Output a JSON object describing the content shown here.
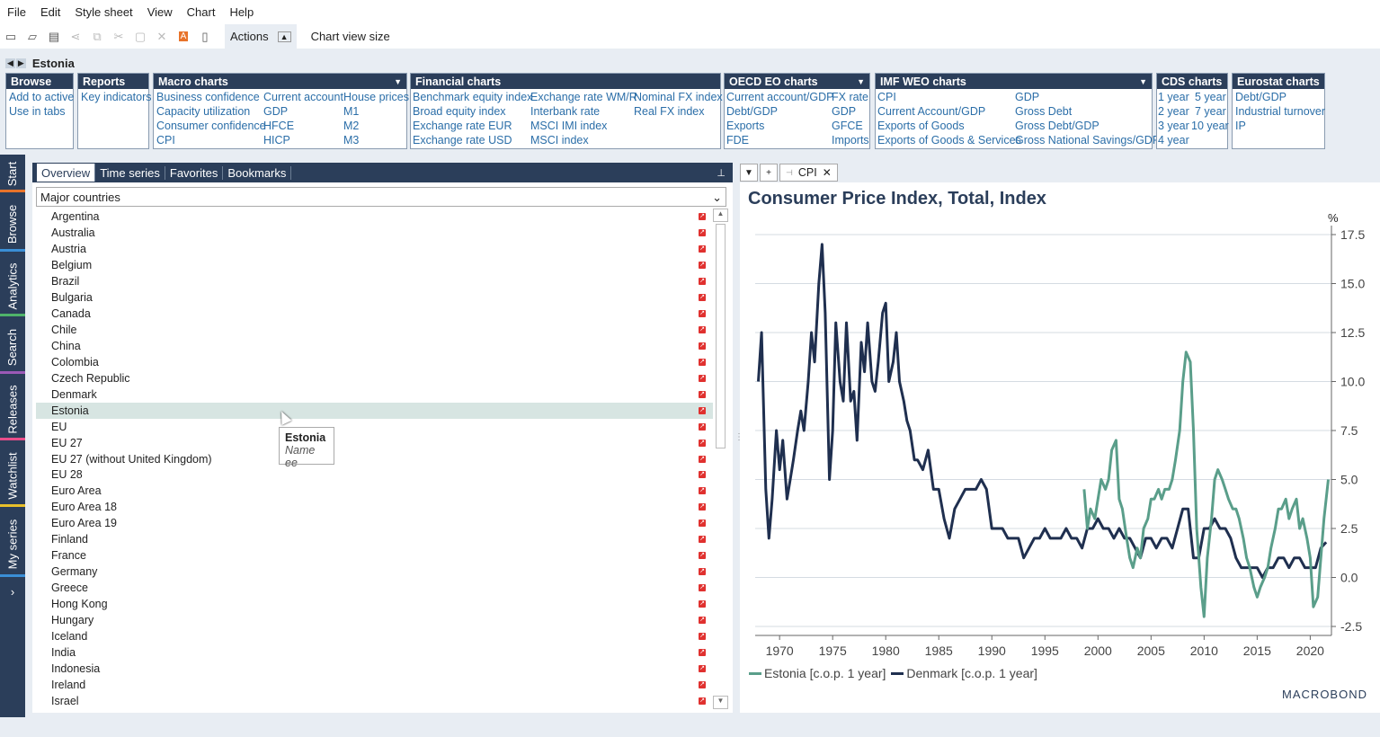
{
  "menu": [
    "File",
    "Edit",
    "Style sheet",
    "View",
    "Chart",
    "Help"
  ],
  "toolbar": {
    "actions_label": "Actions",
    "chart_view_size": "Chart view size"
  },
  "title": "Estonia",
  "panels": {
    "browse": {
      "title": "Browse",
      "items": [
        "Add to active",
        "Use in tabs"
      ]
    },
    "reports": {
      "title": "Reports",
      "items": [
        "Key indicators"
      ]
    },
    "macro": {
      "title": "Macro charts",
      "items": [
        "Business confidence",
        "Capacity utilization",
        "Consumer confidence",
        "CPI",
        "Current account",
        "GDP",
        "HFCE",
        "HICP",
        "House prices",
        "M1",
        "M2",
        "M3"
      ]
    },
    "financial": {
      "title": "Financial charts",
      "items": [
        "Benchmark equity index",
        "Broad equity index",
        "Exchange rate EUR",
        "Exchange rate USD",
        "Exchange rate WM/R",
        "Interbank rate",
        "MSCI IMI index",
        "MSCI index",
        "Nominal FX index",
        "Real FX index"
      ]
    },
    "oecd": {
      "title": "OECD EO charts",
      "items": [
        "Current account/GDP",
        "Debt/GDP",
        "Exports",
        "FDE",
        "FX rate",
        "GDP",
        "GFCE",
        "Imports"
      ]
    },
    "imf": {
      "title": "IMF WEO charts",
      "items": [
        "CPI",
        "Current Account/GDP",
        "Exports of Goods",
        "Exports of Goods & Services",
        "GDP",
        "Gross Debt",
        "Gross Debt/GDP",
        "Gross National Savings/GDP"
      ]
    },
    "cds": {
      "title": "CDS charts",
      "items": [
        "1 year",
        "2 year",
        "3 year",
        "4 year",
        "5 year",
        "7 year",
        "10 year"
      ]
    },
    "eurostat": {
      "title": "Eurostat charts",
      "items": [
        "Debt/GDP",
        "Industrial turnover",
        "IP"
      ]
    }
  },
  "sidetabs": [
    "Start",
    "Browse",
    "Analytics",
    "Search",
    "Releases",
    "Watchlist",
    "My series"
  ],
  "left": {
    "tabs": [
      "Overview",
      "Time series",
      "Favorites",
      "Bookmarks"
    ],
    "dropdown": "Major countries",
    "countries": [
      "Argentina",
      "Australia",
      "Austria",
      "Belgium",
      "Brazil",
      "Bulgaria",
      "Canada",
      "Chile",
      "China",
      "Colombia",
      "Czech Republic",
      "Denmark",
      "Estonia",
      "EU",
      "EU 27",
      "EU 27 (without United Kingdom)",
      "EU 28",
      "Euro Area",
      "Euro Area 18",
      "Euro Area 19",
      "Finland",
      "France",
      "Germany",
      "Greece",
      "Hong Kong",
      "Hungary",
      "Iceland",
      "India",
      "Indonesia",
      "Ireland",
      "Israel"
    ],
    "selected": "Estonia",
    "tooltip": {
      "title": "Estonia",
      "sub": "Name ee"
    }
  },
  "right": {
    "tab": "CPI",
    "brand": "MACROBOND"
  },
  "colors": {
    "estonia": "#5a9e8a",
    "denmark": "#1f2f4f",
    "header": "#2b3e5a",
    "link": "#2b6ea8"
  },
  "chart_data": {
    "type": "line",
    "title": "Consumer Price Index, Total, Index",
    "unit": "%",
    "xlim": [
      1967.7,
      2022
    ],
    "ylim": [
      -2.5,
      17.5
    ],
    "xticks": [
      1970,
      1975,
      1980,
      1985,
      1990,
      1995,
      2000,
      2005,
      2010,
      2015,
      2020
    ],
    "yticks": [
      -2.5,
      0.0,
      2.5,
      5.0,
      7.5,
      10.0,
      12.5,
      15.0,
      17.5
    ],
    "ytick_labels": [
      "-2.5",
      "0.0",
      "2.5",
      "5.0",
      "7.5",
      "10.0",
      "12.5",
      "15.0",
      "17.5"
    ],
    "series": [
      {
        "name": "Denmark [c.o.p. 1 year]",
        "color": "#1f2f4f",
        "x": [
          1968.0,
          1968.3,
          1968.7,
          1969.0,
          1969.3,
          1969.7,
          1970.0,
          1970.3,
          1970.7,
          1971.0,
          1971.3,
          1971.7,
          1972.0,
          1972.3,
          1972.7,
          1973.0,
          1973.3,
          1973.7,
          1974.0,
          1974.3,
          1974.7,
          1975.0,
          1975.3,
          1975.7,
          1976.0,
          1976.3,
          1976.7,
          1977.0,
          1977.3,
          1977.7,
          1978.0,
          1978.3,
          1978.7,
          1979.0,
          1979.3,
          1979.7,
          1980.0,
          1980.3,
          1980.7,
          1981.0,
          1981.3,
          1981.7,
          1982.0,
          1982.3,
          1982.7,
          1983.0,
          1983.5,
          1984.0,
          1984.5,
          1985.0,
          1985.5,
          1986.0,
          1986.5,
          1987.0,
          1987.5,
          1988.0,
          1988.5,
          1989.0,
          1989.5,
          1990.0,
          1990.5,
          1991.0,
          1991.5,
          1992.0,
          1992.5,
          1993.0,
          1993.5,
          1994.0,
          1994.5,
          1995.0,
          1995.5,
          1996.0,
          1996.5,
          1997.0,
          1997.5,
          1998.0,
          1998.5,
          1999.0,
          1999.5,
          2000.0,
          2000.5,
          2001.0,
          2001.5,
          2002.0,
          2002.5,
          2003.0,
          2003.5,
          2004.0,
          2004.5,
          2005.0,
          2005.5,
          2006.0,
          2006.5,
          2007.0,
          2007.5,
          2008.0,
          2008.5,
          2009.0,
          2009.5,
          2010.0,
          2010.5,
          2011.0,
          2011.5,
          2012.0,
          2012.5,
          2013.0,
          2013.5,
          2014.0,
          2014.5,
          2015.0,
          2015.5,
          2016.0,
          2016.5,
          2017.0,
          2017.5,
          2018.0,
          2018.5,
          2019.0,
          2019.5,
          2020.0,
          2020.5,
          2021.0,
          2021.5
        ],
        "y": [
          10.0,
          12.5,
          4.5,
          2.0,
          4.0,
          7.5,
          5.5,
          7.0,
          4.0,
          5.0,
          6.0,
          7.5,
          8.5,
          7.5,
          10.0,
          12.5,
          11.0,
          15.0,
          17.0,
          13.5,
          5.0,
          7.5,
          13.0,
          10.0,
          9.0,
          13.0,
          9.0,
          9.5,
          7.0,
          12.0,
          10.5,
          13.0,
          10.0,
          9.5,
          11.0,
          13.5,
          14.0,
          10.0,
          11.0,
          12.5,
          10.0,
          9.0,
          8.0,
          7.5,
          6.0,
          6.0,
          5.5,
          6.5,
          4.5,
          4.5,
          3.0,
          2.0,
          3.5,
          4.0,
          4.5,
          4.5,
          4.5,
          5.0,
          4.5,
          2.5,
          2.5,
          2.5,
          2.0,
          2.0,
          2.0,
          1.0,
          1.5,
          2.0,
          2.0,
          2.5,
          2.0,
          2.0,
          2.0,
          2.5,
          2.0,
          2.0,
          1.5,
          2.5,
          2.5,
          3.0,
          2.5,
          2.5,
          2.0,
          2.5,
          2.0,
          2.0,
          1.5,
          1.0,
          2.0,
          2.0,
          1.5,
          2.0,
          2.0,
          1.5,
          2.5,
          3.5,
          3.5,
          1.0,
          1.0,
          2.5,
          2.5,
          3.0,
          2.5,
          2.5,
          2.0,
          1.0,
          0.5,
          0.5,
          0.5,
          0.5,
          0.0,
          0.5,
          0.5,
          1.0,
          1.0,
          0.5,
          1.0,
          1.0,
          0.5,
          0.5,
          0.5,
          1.5,
          1.8
        ]
      },
      {
        "name": "Estonia [c.o.p. 1 year]",
        "color": "#5a9e8a",
        "x": [
          1998.7,
          1999.0,
          1999.3,
          1999.7,
          2000.0,
          2000.3,
          2000.7,
          2001.0,
          2001.3,
          2001.7,
          2002.0,
          2002.3,
          2002.7,
          2003.0,
          2003.3,
          2003.7,
          2004.0,
          2004.3,
          2004.7,
          2005.0,
          2005.3,
          2005.7,
          2006.0,
          2006.3,
          2006.7,
          2007.0,
          2007.3,
          2007.7,
          2008.0,
          2008.3,
          2008.7,
          2009.0,
          2009.3,
          2009.7,
          2010.0,
          2010.3,
          2010.7,
          2011.0,
          2011.3,
          2011.7,
          2012.0,
          2012.3,
          2012.7,
          2013.0,
          2013.3,
          2013.7,
          2014.0,
          2014.3,
          2014.7,
          2015.0,
          2015.3,
          2015.7,
          2016.0,
          2016.3,
          2016.7,
          2017.0,
          2017.3,
          2017.7,
          2018.0,
          2018.3,
          2018.7,
          2019.0,
          2019.3,
          2019.7,
          2020.0,
          2020.3,
          2020.7,
          2021.0,
          2021.3,
          2021.7
        ],
        "y": [
          4.5,
          2.5,
          3.5,
          3.0,
          4.0,
          5.0,
          4.5,
          5.0,
          6.5,
          7.0,
          4.0,
          3.5,
          2.0,
          1.0,
          0.5,
          1.5,
          1.0,
          2.5,
          3.0,
          4.0,
          4.0,
          4.5,
          4.0,
          4.5,
          4.5,
          5.0,
          6.0,
          7.5,
          10.0,
          11.5,
          11.0,
          7.5,
          2.5,
          -0.5,
          -2.0,
          1.0,
          3.0,
          5.0,
          5.5,
          5.0,
          4.5,
          4.0,
          3.5,
          3.5,
          3.0,
          2.0,
          1.0,
          0.5,
          -0.5,
          -1.0,
          -0.5,
          0.0,
          0.5,
          1.5,
          2.5,
          3.5,
          3.5,
          4.0,
          3.0,
          3.5,
          4.0,
          2.5,
          3.0,
          2.0,
          1.0,
          -1.5,
          -1.0,
          1.0,
          3.0,
          5.0
        ]
      }
    ]
  }
}
